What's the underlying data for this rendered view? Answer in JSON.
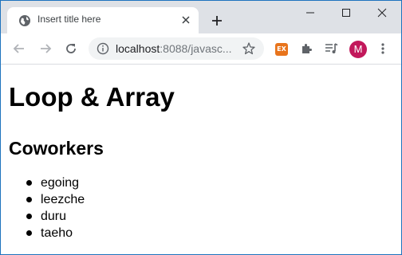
{
  "browser": {
    "tab": {
      "title": "Insert title here"
    },
    "address_bar": {
      "host": "localhost",
      "path": ":8088/javasc..."
    },
    "extension_label": "EX",
    "profile_initial": "M"
  },
  "page": {
    "heading": "Loop & Array",
    "subheading": "Coworkers",
    "coworkers": [
      "egoing",
      "leezche",
      "duru",
      "taeho"
    ]
  },
  "colors": {
    "tabstrip": "#dee1e6",
    "avatar": "#c2185b",
    "extension": "#e8741c",
    "window_border": "#1e73be"
  }
}
